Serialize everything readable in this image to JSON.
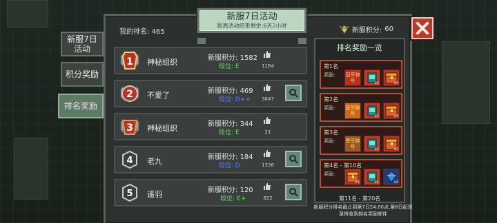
{
  "header": {
    "title": "新服7日活动",
    "countdown": "距离活动结束剩余:6天2小时",
    "my_rank_label": "我的排名:",
    "my_rank_value": "465",
    "my_points_label": "新服积分:",
    "my_points_value": "60"
  },
  "tabs": [
    {
      "label": "新服7日\n活动",
      "active": false
    },
    {
      "label": "积分奖励",
      "active": false
    },
    {
      "label": "排名奖励",
      "active": true
    }
  ],
  "rankings": [
    {
      "rank": 1,
      "name": "神秘组织",
      "score_label": "新服积分:",
      "score": "1582",
      "tier": "段位: E",
      "tier_color": "#6fdc6f",
      "likes": "1164",
      "has_search": false
    },
    {
      "rank": 2,
      "name": "不爱了",
      "score_label": "新服积分:",
      "score": "469",
      "tier": "段位: D++",
      "tier_color": "#5a86ff",
      "likes": "3847",
      "has_search": true
    },
    {
      "rank": 3,
      "name": "神秘组织",
      "score_label": "新服积分:",
      "score": "344",
      "tier": "段位: E",
      "tier_color": "#6fdc6f",
      "likes": "21",
      "has_search": false
    },
    {
      "rank": 4,
      "name": "老九",
      "score_label": "新服积分:",
      "score": "184",
      "tier": "段位: D",
      "tier_color": "#5a86ff",
      "likes": "1336",
      "has_search": true
    },
    {
      "rank": 5,
      "name": "遥羽",
      "score_label": "新服积分:",
      "score": "120",
      "tier": "段位: E+",
      "tier_color": "#6fdc6f",
      "likes": "822",
      "has_search": true
    }
  ],
  "rewards": {
    "title": "排名奖励一览",
    "reward_label": "奖励:",
    "tiers": [
      {
        "rank": "第1名",
        "title_text": "冠军称号",
        "counts": [
          "x1",
          "x4"
        ]
      },
      {
        "rank": "第2名",
        "title_text": "亚军称号",
        "counts": [
          "x1",
          "x3"
        ]
      },
      {
        "rank": "第3名",
        "title_text": "季军称号",
        "counts": [
          "x1",
          "x2"
        ]
      },
      {
        "rank": "第4名 - 第10名",
        "title_text": "",
        "counts": [
          "x1",
          "x1",
          "x2"
        ]
      }
    ],
    "next_tier": "第11名 - 第20名",
    "note": "新服积分排名截止到第7日24:00点,第8日起登录将收到排名奖励邮件"
  },
  "colors": {
    "accent": "#bcd6c2",
    "close": "#b83a2a",
    "tier_green": "#6fdc6f",
    "tier_blue": "#5a86ff"
  },
  "icons": [
    "points-gem-icon",
    "close-icon",
    "rank-medal-icon",
    "like-icon",
    "search-icon",
    "reward-chest-icon"
  ]
}
